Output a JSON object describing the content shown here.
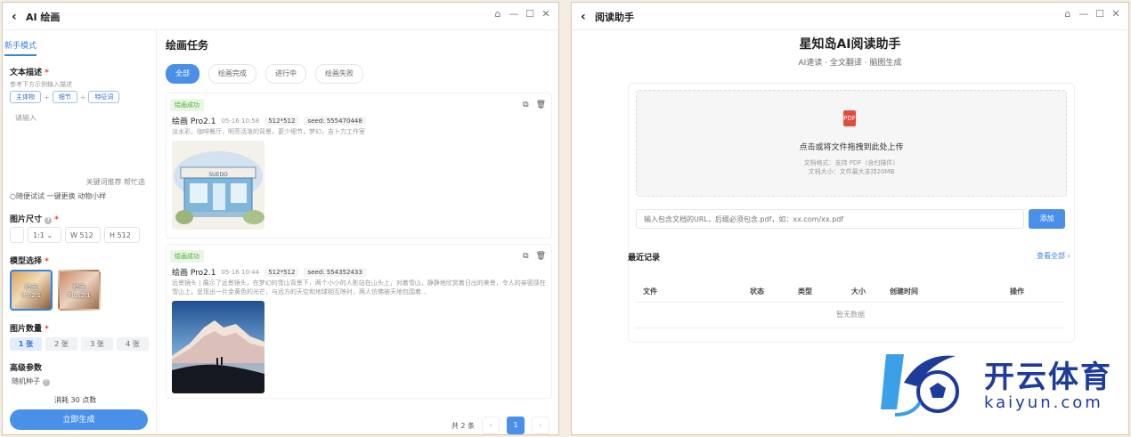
{
  "left_window": {
    "title": "AI 绘画",
    "controls": [
      "⌂",
      "—",
      "☐",
      "✕"
    ],
    "tab": "新手模式",
    "text_section": {
      "label": "文本描述",
      "required_mark": "*",
      "hint": "参考下方示例输入描述",
      "chips": [
        "主体物",
        "细节",
        "特征词"
      ],
      "placeholder": "请输入",
      "links": "关键词推荐  帮忙选",
      "radio_text": "○随便试试  一键更换  动物小样"
    },
    "size_section": {
      "label": "图片尺寸",
      "help": "?",
      "ratio": "1:1",
      "width": "W 512",
      "height": "H 512"
    },
    "model_section": {
      "label": "模型选择",
      "models": [
        "绘画\nPro2.1",
        "绘画\nPlus2.1"
      ]
    },
    "quantity_section": {
      "label": "图片数量",
      "options": [
        "1 张",
        "2 张",
        "3 张",
        "4 张"
      ],
      "selected": 0
    },
    "advanced": {
      "label": "高级参数",
      "seed_label": "随机种子"
    },
    "cost": "消耗  30  点数",
    "generate_label": "立即生成",
    "tasks_panel": {
      "title": "绘画任务",
      "filters": [
        "全部",
        "绘画完成",
        "进行中",
        "绘画失败"
      ],
      "tasks": [
        {
          "status": "绘画成功",
          "model": "绘画 Pro2.1",
          "time": "05-16 10:58",
          "size": "512*512",
          "seed": "seed: 555470448",
          "prompt": "淡水彩，咖啡餐厅，明亮活泼的背景，更少细节，梦幻，吉卜力工作室"
        },
        {
          "status": "绘画成功",
          "model": "绘画 Pro2.1",
          "time": "05-16 10:44",
          "size": "512*512",
          "seed": "seed: 554352433",
          "prompt": "远景镜头 | 展示了远景镜头，在梦幻的雪山背景下，两个小小的人影站在山头上，对着雪山，静静地欣赏着日出的美景，令人的亲密感在雪山上，呈现出一片金黄色的光芒，与远方的天空和地球相互映衬，两人仿佛被天地包围着..."
        }
      ],
      "pager": {
        "total": "共 2 条",
        "prev": "‹",
        "current": "1",
        "next": "›"
      }
    }
  },
  "right_window": {
    "title": "阅读助手",
    "controls": [
      "⌂",
      "—",
      "☐",
      "✕"
    ],
    "heading": "星知岛AI阅读助手",
    "subheading": "AI速读 · 全文翻译 · 脑图生成",
    "dropzone": {
      "icon_label": "PDF",
      "main_text": "点击或将文件拖拽到此处上传",
      "note_1": "文档格式：支持 PDF（含扫描件）",
      "note_2": "文档大小：文件最大支持20MB"
    },
    "url_placeholder": "输入包含文档的URL，后缀必须包含.pdf，如：xx.com/xx.pdf",
    "add_label": "添加",
    "recent_title": "最近记录",
    "view_all": "查看全部 ›",
    "table_headers": [
      "文件",
      "状态",
      "类型",
      "大小",
      "创建时间",
      "操作"
    ],
    "empty_text": "暂无数据"
  },
  "logo": {
    "cn": "开云体育",
    "en": "kaiyun.com"
  },
  "colors": {
    "accent": "#4a90e8",
    "success_text": "#52a83a",
    "success_bg": "#e8f7e3",
    "pdf_red": "#e34c3c",
    "logo_blue": "#1d3b9a"
  },
  "icons": {
    "back": "‹",
    "copy": "⧉",
    "delete": "🗑"
  }
}
